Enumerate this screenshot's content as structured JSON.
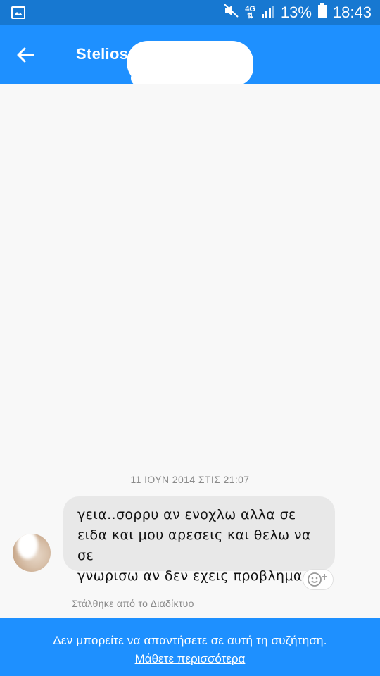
{
  "status_bar": {
    "battery": "13%",
    "time": "18:43",
    "network": "4G",
    "icons": [
      "gallery-icon",
      "mute-icon",
      "network-4g-icon",
      "signal-icon",
      "battery-icon"
    ]
  },
  "header": {
    "contact_name": "Stelios",
    "back_icon": "arrow-left-icon"
  },
  "conversation": {
    "timestamp": "11 ΙΟΥΝ 2014 ΣΤΙΣ 21:07",
    "messages": [
      {
        "lines": [
          "γεια..σορρυ αν ενοχλω αλλα σε",
          "ειδα και μου αρεσεις και θελω να σε",
          "γνωρισω αν δεν εχεις προβλημα.."
        ]
      }
    ],
    "sent_via": "Στάλθηκε από το Διαδίκτυο"
  },
  "footer": {
    "notice": "Δεν μπορείτε να απαντήσετε σε αυτή τη συζήτηση.",
    "learn_more": "Μάθετε περισσότερα"
  },
  "colors": {
    "status_bar": "#1778d1",
    "app_bar": "#1e90ff",
    "bubble": "#e8e8e8",
    "background": "#f8f8f8"
  }
}
